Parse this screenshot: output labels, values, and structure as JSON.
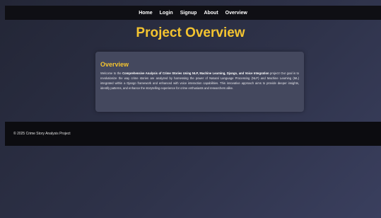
{
  "nav": {
    "items": [
      {
        "label": "Home"
      },
      {
        "label": "Login"
      },
      {
        "label": "Signup"
      },
      {
        "label": "About"
      },
      {
        "label": "Overview"
      }
    ]
  },
  "page": {
    "title": "Project Overview"
  },
  "card": {
    "heading": "Overview",
    "text_1": "Welcome to the ",
    "text_bold": "Comprehensive Analysis of Crime Stories Using NLP, Machine Learning, Django, and Voice Integration",
    "text_2": " project! Our goal is to revolutionize the way crime stories are analyzed by harnessing the power of Natural Language Processing (NLP) and Machine Learning (ML) integrated within a Django framework and enhanced with voice interaction capabilities. This innovative approach aims to provide deeper insights, identify patterns, and enhance the storytelling experience for crime enthusiasts and researchers alike."
  },
  "footer": {
    "text": "© 2025 Crime Story Analysis Project"
  },
  "colors": {
    "accent": "#f4c430",
    "navbar_bg": "#0f0f14",
    "card_bg": "#44485e"
  }
}
